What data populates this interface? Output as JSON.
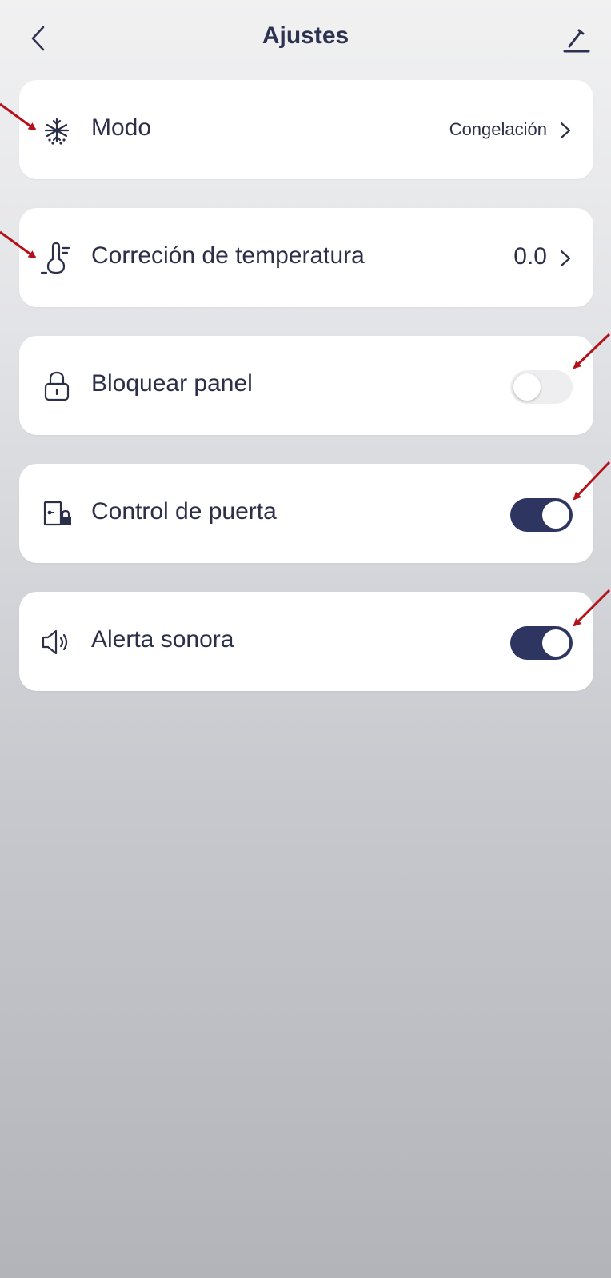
{
  "header": {
    "title": "Ajustes",
    "back_icon": "chevron-left-icon",
    "edit_icon": "pencil-icon"
  },
  "settings": {
    "mode": {
      "label": "Modo",
      "value": "Congelación",
      "icon": "snowflake-icon"
    },
    "temp_correction": {
      "label": "Correción de temperatura",
      "value": "0.0",
      "icon": "thermometer-icon"
    },
    "lock_panel": {
      "label": "Bloquear panel",
      "enabled": false,
      "icon": "lock-icon"
    },
    "door_control": {
      "label": "Control de puerta",
      "enabled": true,
      "icon": "door-lock-icon"
    },
    "sound_alert": {
      "label": "Alerta sonora",
      "enabled": true,
      "icon": "speaker-icon"
    }
  },
  "colors": {
    "text": "#2b2f48",
    "toggle_on": "#2f3561",
    "toggle_off": "#eeeef0",
    "annotation_arrow": "#b3121a"
  }
}
